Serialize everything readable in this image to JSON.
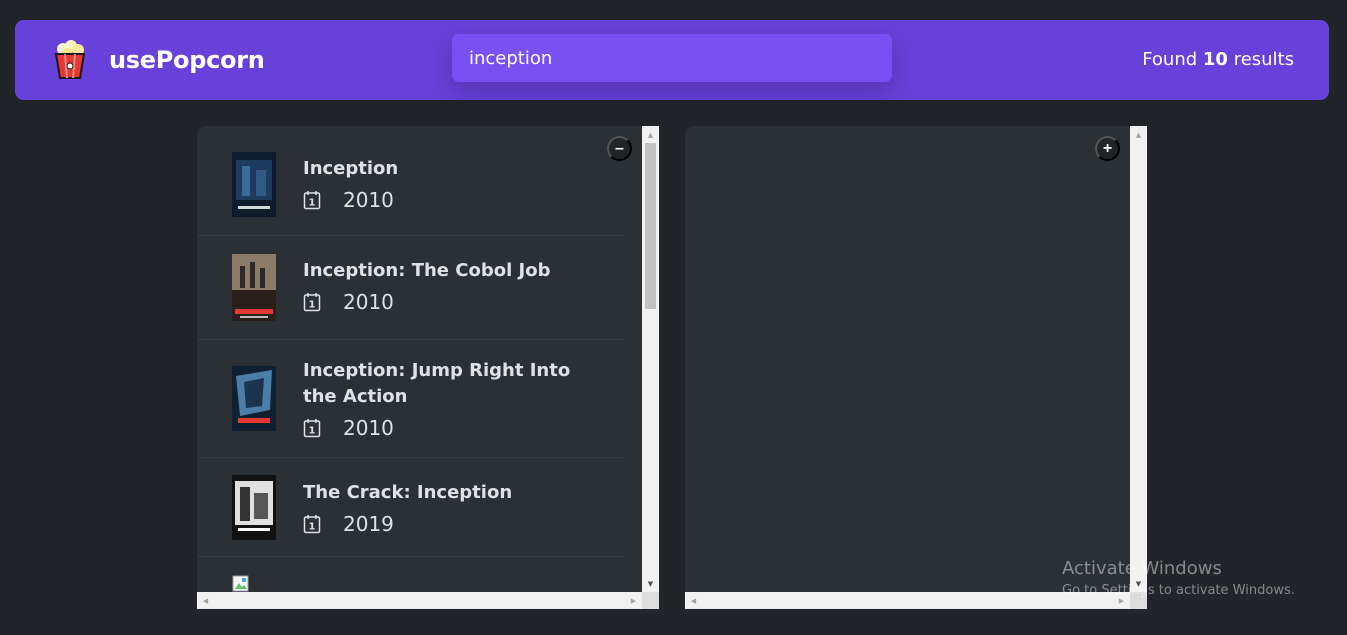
{
  "nav": {
    "logo_text": "usePopcorn",
    "search_value": "inception",
    "results_prefix": "Found ",
    "results_count": "10",
    "results_suffix": " results"
  },
  "left_box": {
    "toggle_label": "–"
  },
  "right_box": {
    "toggle_label": "+"
  },
  "movies": [
    {
      "title": "Inception",
      "year": "2010"
    },
    {
      "title": "Inception: The Cobol Job",
      "year": "2010"
    },
    {
      "title": "Inception: Jump Right Into the Action",
      "year": "2010"
    },
    {
      "title": "The Crack: Inception",
      "year": "2019"
    }
  ],
  "watermark": {
    "line1": "Activate Windows",
    "line2": "Go to Settings to activate Windows."
  },
  "colors": {
    "brand": "#6741d9",
    "search_bg": "#7950f2",
    "background": "#212529",
    "box": "#2b3035"
  }
}
